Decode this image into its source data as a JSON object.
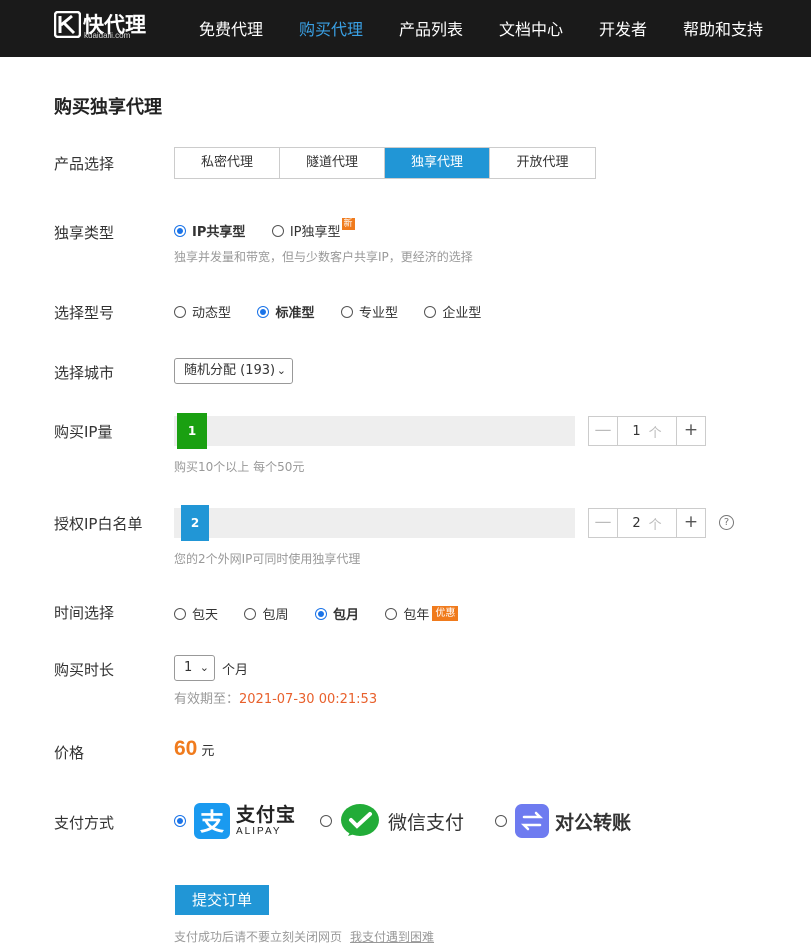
{
  "logo": {
    "name": "快代理",
    "domain": "kuaidaili.com"
  },
  "nav": [
    {
      "label": "免费代理",
      "active": false
    },
    {
      "label": "购买代理",
      "active": true
    },
    {
      "label": "产品列表",
      "active": false
    },
    {
      "label": "文档中心",
      "active": false
    },
    {
      "label": "开发者",
      "active": false
    },
    {
      "label": "帮助和支持",
      "active": false
    }
  ],
  "page_title": "购买独享代理",
  "product": {
    "label": "产品选择",
    "tabs": [
      "私密代理",
      "隧道代理",
      "独享代理",
      "开放代理"
    ],
    "selected": "独享代理"
  },
  "exclusive_type": {
    "label": "独享类型",
    "options": [
      "IP共享型",
      "IP独享型"
    ],
    "selected": "IP共享型",
    "new_badge": "新",
    "hint": "独享并发量和带宽，但与少数客户共享IP，更经济的选择"
  },
  "model": {
    "label": "选择型号",
    "options": [
      "动态型",
      "标准型",
      "专业型",
      "企业型"
    ],
    "selected": "标准型"
  },
  "city": {
    "label": "选择城市",
    "value": "随机分配 (193)"
  },
  "ip_count": {
    "label": "购买IP量",
    "value": "1",
    "unit": "个",
    "hint": "购买10个以上 每个50元"
  },
  "whitelist": {
    "label": "授权IP白名单",
    "value": "2",
    "unit": "个",
    "help": "?",
    "hint": "您的2个外网IP可同时使用独享代理"
  },
  "period": {
    "label": "时间选择",
    "options": [
      "包天",
      "包周",
      "包月",
      "包年"
    ],
    "selected": "包月",
    "deal_badge": "优惠"
  },
  "duration": {
    "label": "购买时长",
    "value": "1",
    "unit": "个月",
    "expiry_label": "有效期至：",
    "expiry_date": "2021-07-30 00:21:53"
  },
  "price": {
    "label": "价格",
    "amount": "60",
    "currency": "元"
  },
  "payment": {
    "label": "支付方式",
    "alipay_cn": "支付宝",
    "alipay_en": "ALIPAY",
    "wechat": "微信支付",
    "transfer": "对公转账",
    "selected": "alipay"
  },
  "submit_label": "提交订单",
  "footer": {
    "note": "支付成功后请不要立刻关闭网页",
    "link": "我支付遇到困难"
  },
  "colors": {
    "accent": "#2196d6",
    "green": "#1aa011",
    "orange": "#f07b1d",
    "nav_bg": "#1a1a1a"
  }
}
